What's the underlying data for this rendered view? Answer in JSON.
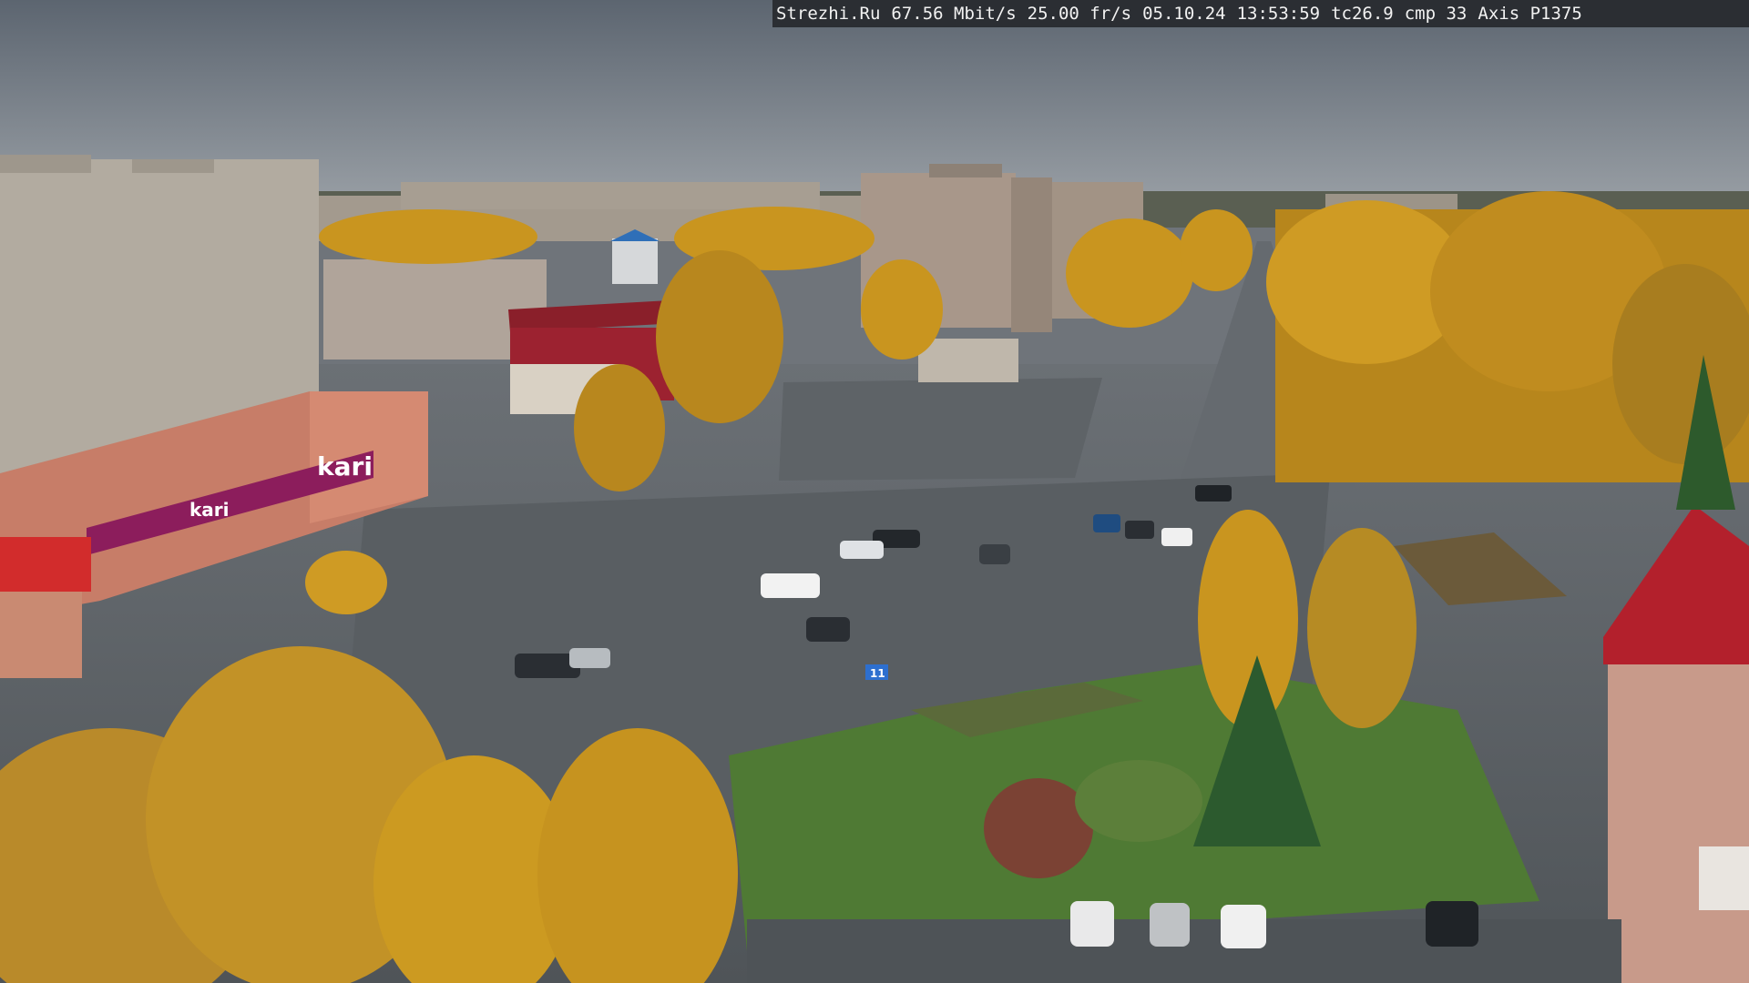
{
  "overlay": {
    "site": "Strezhi.Ru",
    "bitrate": "67.56 Mbit/s",
    "fps": "25.00 fr/s",
    "date": "05.10.24",
    "time": "13:53:59",
    "tc": "tc26.9",
    "cmp": "cmp 33",
    "camera": "Axis P1375"
  },
  "signs": {
    "store_main": "kari",
    "store_sub": "kari",
    "road_sign": "11"
  },
  "colors": {
    "sky": "#7d848c",
    "asphalt": "#5c6166",
    "foliage": "#c9951f",
    "grass": "#4f7a34",
    "store_magenta": "#8c1d5c",
    "roof_red": "#b3202c"
  }
}
